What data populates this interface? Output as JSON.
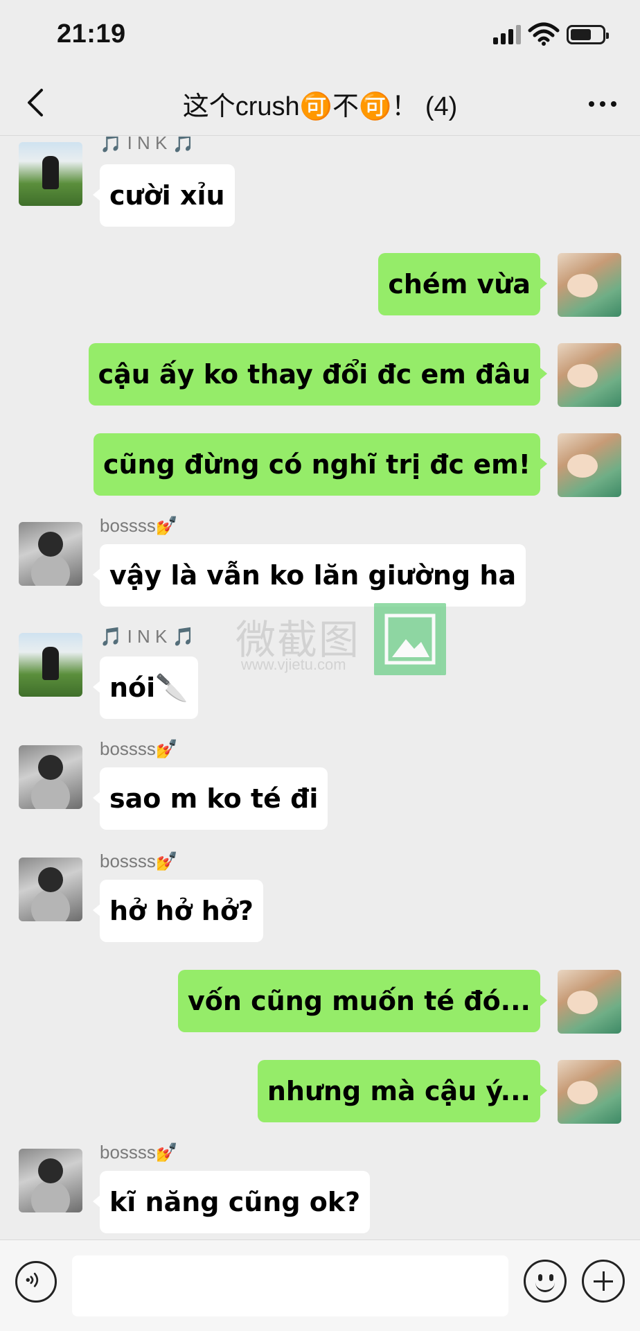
{
  "status_bar": {
    "time": "21:19"
  },
  "header": {
    "title": "这个crush🉑不🉑！ (4)"
  },
  "messages": [
    {
      "side": "in",
      "sender": "🎵 I N K 🎵",
      "avatar": "ink",
      "text": "cười xỉu"
    },
    {
      "side": "out",
      "text": "chém vừa"
    },
    {
      "side": "out",
      "text": "cậu ấy ko thay đổi đc em đâu"
    },
    {
      "side": "out",
      "text": "cũng đừng có nghĩ trị đc em!"
    },
    {
      "side": "in",
      "sender": "bossss💅",
      "avatar": "boss",
      "text": "vậy là vẫn ko lăn giường ha"
    },
    {
      "side": "in",
      "sender": "🎵 I N K 🎵",
      "avatar": "ink",
      "text": "nói🔪"
    },
    {
      "side": "in",
      "sender": "bossss💅",
      "avatar": "boss",
      "text": "sao m ko té đi"
    },
    {
      "side": "in",
      "sender": "bossss💅",
      "avatar": "boss",
      "text": "hở hở hở?"
    },
    {
      "side": "out",
      "text": "vốn cũng muốn té đó..."
    },
    {
      "side": "out",
      "text": "nhưng mà cậu ý..."
    },
    {
      "side": "in",
      "sender": "bossss💅",
      "avatar": "boss",
      "text": "kĩ năng cũng ok?"
    }
  ],
  "watermark": {
    "text": "微截图",
    "url": "www.vjietu.com"
  },
  "input_bar": {
    "placeholder": ""
  },
  "colors": {
    "outgoing_bubble": "#95ec69",
    "incoming_bubble": "#ffffff",
    "background": "#ededed"
  }
}
